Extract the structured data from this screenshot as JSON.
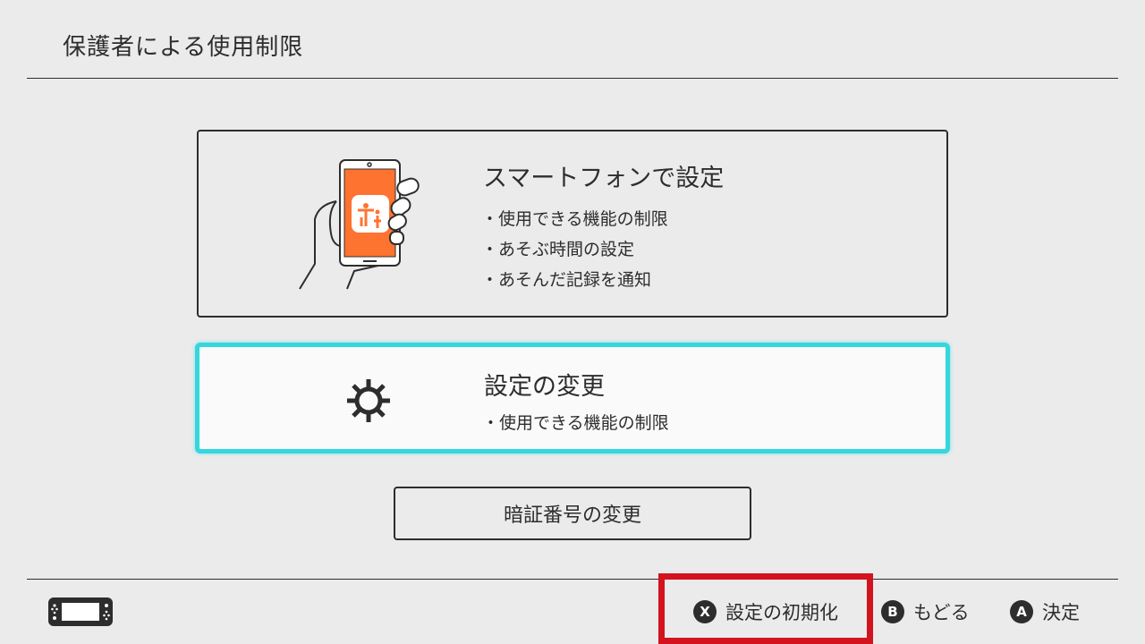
{
  "header": {
    "title": "保護者による使用制限"
  },
  "options": {
    "smartphone": {
      "title": "スマートフォンで設定",
      "features": [
        "使用できる機能の制限",
        "あそぶ時間の設定",
        "あそんだ記録を通知"
      ],
      "icon": "smartphone-hand-icon",
      "app_color": "#ff7330"
    },
    "change_settings": {
      "title": "設定の変更",
      "features": [
        "使用できる機能の制限"
      ],
      "icon": "gear-icon",
      "focus_color": "#35d7df"
    },
    "change_pin": {
      "label": "暗証番号の変更"
    }
  },
  "footer": {
    "console_icon": "switch-console-icon",
    "actions": [
      {
        "button": "X",
        "label": "設定の初期化"
      },
      {
        "button": "B",
        "label": "もどる"
      },
      {
        "button": "A",
        "label": "決定"
      }
    ],
    "highlight_color": "#d3131d"
  }
}
